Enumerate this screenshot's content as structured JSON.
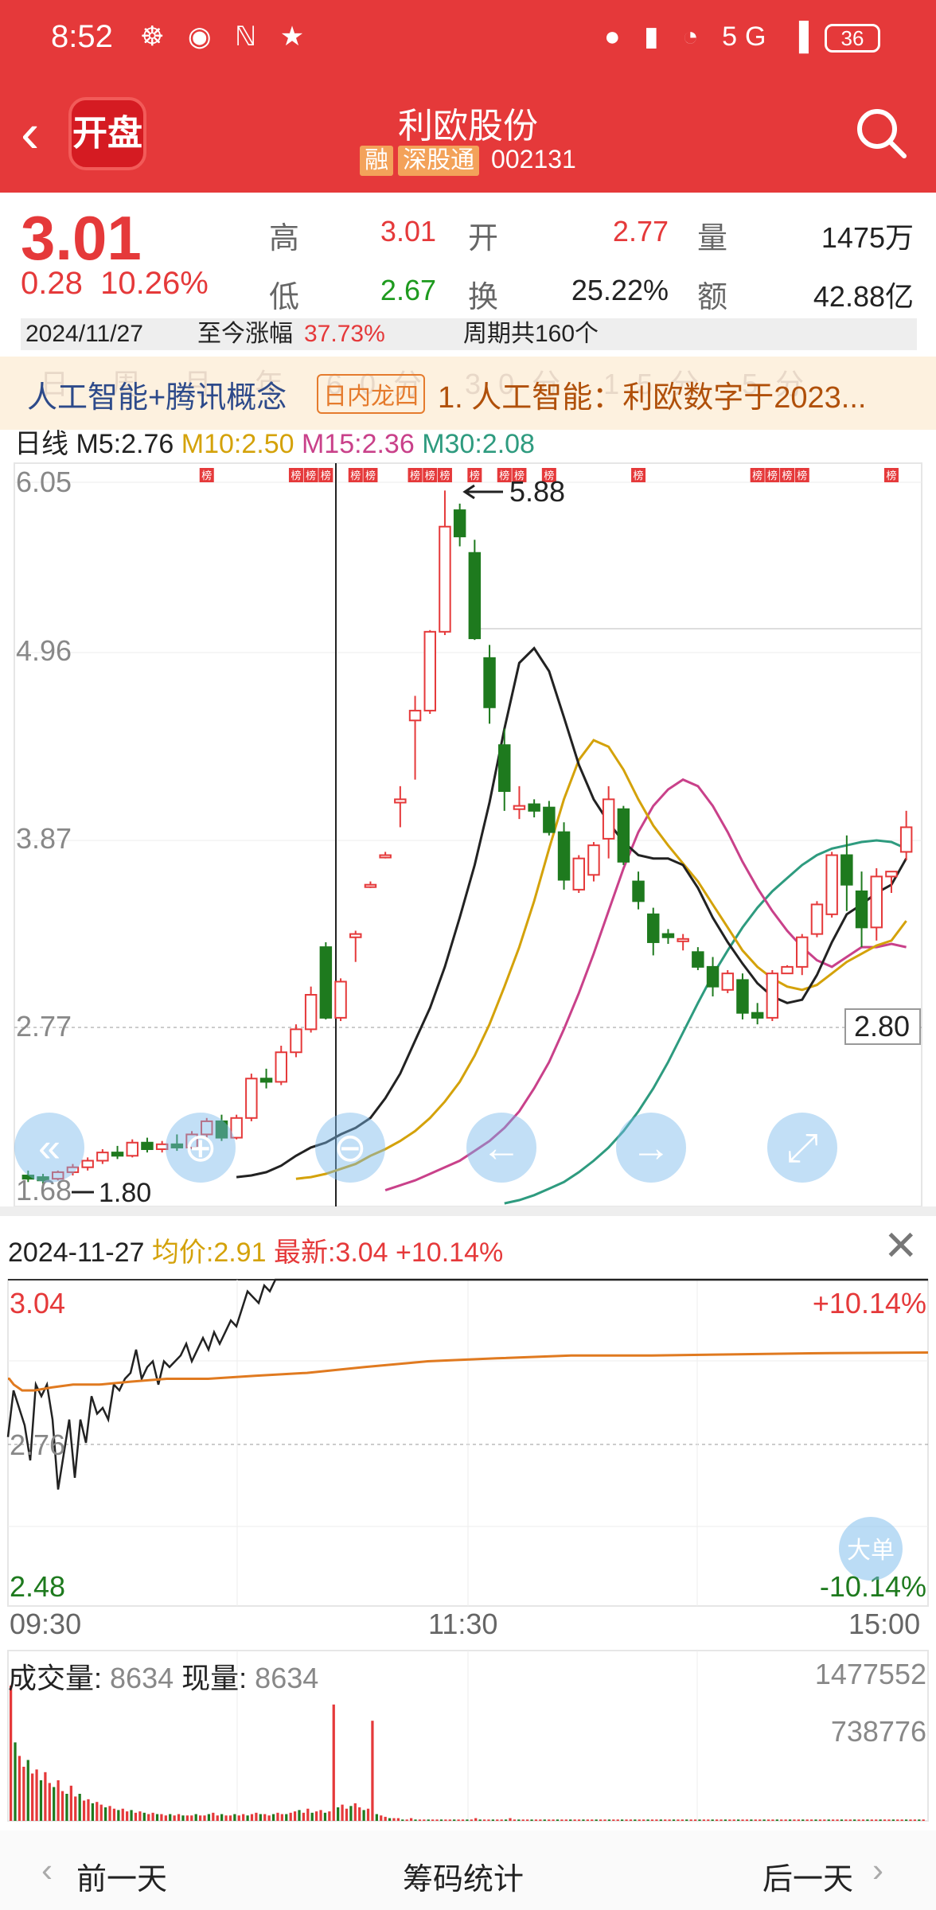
{
  "status_bar": {
    "time": "8:52",
    "battery": "36",
    "left_icons": "☸ ◉ ℕ ★",
    "right_icons": "● ▮ ◔ 5G ▐"
  },
  "header": {
    "app_logo_text": "开盘",
    "stock_name": "利欧股份",
    "tags": [
      "融",
      "深股通"
    ],
    "code": "002131"
  },
  "quote": {
    "price": "3.01",
    "change": "0.28",
    "change_pct": "10.26%",
    "high_label": "高",
    "high": "3.01",
    "open_label": "开",
    "open": "2.77",
    "volume_label": "量",
    "volume": "1475万",
    "low_label": "低",
    "low": "2.67",
    "turnover_label": "换",
    "turnover": "25.22%",
    "amount_label": "额",
    "amount": "42.88亿",
    "date": "2024/11/27",
    "cum_label": "至今涨幅",
    "cum_value": "37.73%",
    "period_text": "周期共160个"
  },
  "concept_bar": {
    "ghost_tabs": "日 周 月 年 60分 30分 15分 5分",
    "concepts": "人工智能+腾讯概念",
    "badge": "日内龙四",
    "news": "1. 人工智能：利欧数字于2023..."
  },
  "ma_legend": {
    "label": "日线",
    "m5": "M5:2.76",
    "m10": "M10:2.50",
    "m15": "M15:2.36",
    "m30": "M30:2.08"
  },
  "colors": {
    "up": "#e5393a",
    "down": "#1e7a1e",
    "m5": "#222222",
    "m10": "#d4a20a",
    "m15": "#c9418a",
    "m30": "#2e9b7f"
  },
  "kline": {
    "y_labels": [
      "6.05",
      "4.96",
      "3.87",
      "2.77",
      "1.68"
    ],
    "marker_high": "5.88",
    "marker_low": "1.80",
    "last_price_box": "2.80",
    "bang": "榜",
    "nav_icons": [
      "double-left-icon",
      "zoom-in-icon",
      "zoom-out-icon",
      "left-arrow-icon",
      "right-arrow-icon",
      "expand-icon"
    ]
  },
  "chart_data": [
    {
      "type": "candlestick",
      "title": "",
      "ylim": [
        1.68,
        6.05
      ],
      "y_ticks": [
        6.05,
        4.96,
        3.87,
        2.77,
        1.68
      ],
      "candles": [
        [
          1.83,
          1.86,
          1.79,
          1.81
        ],
        [
          1.82,
          1.84,
          1.78,
          1.8
        ],
        [
          1.81,
          1.86,
          1.8,
          1.85
        ],
        [
          1.85,
          1.9,
          1.83,
          1.88
        ],
        [
          1.88,
          1.94,
          1.86,
          1.92
        ],
        [
          1.92,
          1.99,
          1.9,
          1.97
        ],
        [
          1.97,
          2.01,
          1.93,
          1.95
        ],
        [
          1.95,
          2.05,
          1.94,
          2.03
        ],
        [
          2.03,
          2.06,
          1.97,
          1.99
        ],
        [
          1.99,
          2.04,
          1.97,
          2.02
        ],
        [
          2.02,
          2.08,
          1.98,
          2.0
        ],
        [
          2.0,
          2.1,
          1.99,
          2.08
        ],
        [
          2.08,
          2.18,
          2.06,
          2.16
        ],
        [
          2.16,
          2.2,
          2.04,
          2.06
        ],
        [
          2.06,
          2.2,
          2.05,
          2.18
        ],
        [
          2.18,
          2.45,
          2.16,
          2.42
        ],
        [
          2.42,
          2.48,
          2.36,
          2.4
        ],
        [
          2.4,
          2.62,
          2.38,
          2.58
        ],
        [
          2.58,
          2.75,
          2.55,
          2.72
        ],
        [
          2.72,
          2.98,
          2.7,
          2.93
        ],
        [
          3.22,
          3.25,
          2.78,
          2.79
        ],
        [
          2.79,
          3.03,
          2.77,
          3.01
        ],
        [
          3.28,
          3.32,
          3.13,
          3.3
        ],
        [
          3.6,
          3.62,
          3.58,
          3.6
        ],
        [
          3.78,
          3.8,
          3.76,
          3.78
        ],
        [
          4.1,
          4.2,
          3.95,
          4.12
        ],
        [
          4.6,
          4.75,
          4.24,
          4.66
        ],
        [
          4.66,
          5.15,
          4.64,
          5.14
        ],
        [
          5.14,
          6.0,
          5.12,
          5.78
        ],
        [
          5.88,
          5.92,
          5.66,
          5.72
        ],
        [
          5.62,
          5.7,
          5.09,
          5.1
        ],
        [
          4.98,
          5.06,
          4.58,
          4.68
        ],
        [
          4.45,
          4.55,
          4.05,
          4.17
        ],
        [
          4.06,
          4.2,
          4.0,
          4.08
        ],
        [
          4.09,
          4.12,
          4.01,
          4.05
        ],
        [
          4.07,
          4.11,
          3.9,
          3.92
        ],
        [
          3.92,
          3.98,
          3.57,
          3.63
        ],
        [
          3.57,
          3.78,
          3.55,
          3.76
        ],
        [
          3.66,
          3.86,
          3.62,
          3.84
        ],
        [
          3.88,
          4.2,
          3.76,
          4.12
        ],
        [
          4.06,
          4.08,
          3.72,
          3.74
        ],
        [
          3.62,
          3.68,
          3.45,
          3.5
        ],
        [
          3.42,
          3.46,
          3.17,
          3.25
        ],
        [
          3.3,
          3.33,
          3.24,
          3.28
        ],
        [
          3.26,
          3.3,
          3.2,
          3.27
        ],
        [
          3.19,
          3.22,
          3.08,
          3.1
        ],
        [
          3.1,
          3.16,
          2.92,
          2.98
        ],
        [
          2.96,
          3.08,
          2.94,
          3.06
        ],
        [
          3.02,
          3.06,
          2.78,
          2.82
        ],
        [
          2.82,
          2.88,
          2.75,
          2.79
        ],
        [
          2.79,
          3.08,
          2.77,
          3.06
        ],
        [
          3.06,
          3.11,
          3.08,
          3.1
        ],
        [
          3.1,
          3.3,
          3.05,
          3.28
        ],
        [
          3.3,
          3.5,
          3.28,
          3.48
        ],
        [
          3.42,
          3.8,
          3.4,
          3.78
        ],
        [
          3.78,
          3.9,
          3.44,
          3.6
        ],
        [
          3.56,
          3.68,
          3.22,
          3.34
        ],
        [
          3.34,
          3.7,
          3.26,
          3.65
        ],
        [
          3.65,
          3.68,
          3.55,
          3.68
        ],
        [
          3.8,
          4.05,
          3.75,
          3.95
        ]
      ],
      "ma5": [
        1.82,
        1.83,
        1.85,
        1.89,
        1.95,
        2.0,
        2.03,
        2.08,
        2.12,
        2.18,
        2.3,
        2.45,
        2.65,
        2.85,
        3.1,
        3.4,
        3.72,
        4.1,
        4.55,
        4.95,
        5.04,
        4.9,
        4.62,
        4.33,
        4.12,
        3.98,
        3.86,
        3.78,
        3.76,
        3.76,
        3.72,
        3.58,
        3.4,
        3.25,
        3.12,
        3.0,
        2.92,
        2.88,
        2.9,
        3.05,
        3.25,
        3.42,
        3.48,
        3.55,
        3.6,
        3.76
      ],
      "ma10": [
        1.81,
        1.82,
        1.84,
        1.87,
        1.9,
        1.95,
        1.99,
        2.04,
        2.1,
        2.18,
        2.28,
        2.4,
        2.56,
        2.75,
        2.98,
        3.22,
        3.5,
        3.82,
        4.12,
        4.36,
        4.48,
        4.44,
        4.3,
        4.12,
        3.96,
        3.84,
        3.73,
        3.62,
        3.48,
        3.34,
        3.2,
        3.1,
        3.03,
        2.98,
        2.96,
        2.99,
        3.06,
        3.13,
        3.18,
        3.23,
        3.26,
        3.38
      ],
      "ma15": [
        1.74,
        1.77,
        1.8,
        1.84,
        1.88,
        1.92,
        1.98,
        2.04,
        2.12,
        2.22,
        2.36,
        2.52,
        2.72,
        2.94,
        3.18,
        3.44,
        3.7,
        3.92,
        4.08,
        4.18,
        4.24,
        4.2,
        4.08,
        3.92,
        3.74,
        3.58,
        3.44,
        3.32,
        3.22,
        3.14,
        3.1,
        3.16,
        3.22,
        3.22,
        3.24,
        3.22
      ],
      "ma30": [
        1.66,
        1.68,
        1.71,
        1.75,
        1.79,
        1.85,
        1.92,
        2.0,
        2.1,
        2.22,
        2.36,
        2.52,
        2.7,
        2.88,
        3.05,
        3.2,
        3.34,
        3.46,
        3.56,
        3.64,
        3.72,
        3.78,
        3.82,
        3.84,
        3.86,
        3.87,
        3.86,
        3.82
      ]
    },
    {
      "type": "line",
      "title": "",
      "date": "2024-11-27",
      "avg_label": "均价:",
      "avg": "2.91",
      "last_label": "最新:",
      "last": "3.04",
      "last_pct": "+10.14%",
      "ylim": [
        2.48,
        3.04
      ],
      "y_labels": {
        "top": "3.04",
        "mid": "2.76",
        "bottom": "2.48",
        "top_pct": "+10.14%",
        "bottom_pct": "-10.14%"
      },
      "x_labels": [
        "09:30",
        "11:30",
        "15:00"
      ],
      "big_order": "大单",
      "price": [
        2.77,
        2.85,
        2.82,
        2.79,
        2.73,
        2.86,
        2.84,
        2.86,
        2.8,
        2.68,
        2.74,
        2.8,
        2.7,
        2.8,
        2.76,
        2.84,
        2.81,
        2.82,
        2.8,
        2.86,
        2.85,
        2.87,
        2.88,
        2.92,
        2.87,
        2.89,
        2.9,
        2.86,
        2.9,
        2.89,
        2.9,
        2.91,
        2.93,
        2.9,
        2.92,
        2.94,
        2.92,
        2.95,
        2.93,
        2.95,
        2.97,
        2.96,
        2.99,
        3.02,
        3.01,
        3.0,
        3.03,
        3.02,
        3.04
      ],
      "price_after": 3.04,
      "avg_series": [
        2.87,
        2.87,
        2.86,
        2.85,
        2.85,
        2.855,
        2.86,
        2.86,
        2.865,
        2.87,
        2.87,
        2.875,
        2.88,
        2.89,
        2.9,
        2.905,
        2.91,
        2.91,
        2.912,
        2.914,
        2.915
      ]
    },
    {
      "type": "bar",
      "title": "",
      "label": "成交量:",
      "value": "8634",
      "now_label": "现量:",
      "now": "8634",
      "y_labels": [
        "1477552",
        "738776"
      ],
      "values": [
        1.0,
        0.58,
        0.48,
        0.4,
        0.45,
        0.35,
        0.38,
        0.3,
        0.36,
        0.28,
        0.25,
        0.3,
        0.22,
        0.2,
        0.26,
        0.18,
        0.2,
        0.15,
        0.16,
        0.13,
        0.14,
        0.12,
        0.1,
        0.11,
        0.09,
        0.08,
        0.09,
        0.07,
        0.08,
        0.06,
        0.07,
        0.06,
        0.05,
        0.06,
        0.05,
        0.05,
        0.04,
        0.05,
        0.04,
        0.05,
        0.04,
        0.04,
        0.04,
        0.05,
        0.04,
        0.04,
        0.05,
        0.06,
        0.04,
        0.05,
        0.04,
        0.04,
        0.05,
        0.04,
        0.05,
        0.04,
        0.05,
        0.06,
        0.05,
        0.05,
        0.04,
        0.05,
        0.06,
        0.05,
        0.05,
        0.06,
        0.07,
        0.08,
        0.06,
        0.09,
        0.06,
        0.07,
        0.08,
        0.06,
        0.07,
        0.86,
        0.1,
        0.12,
        0.09,
        0.11,
        0.13,
        0.1,
        0.08,
        0.09,
        0.74,
        0.05,
        0.04,
        0.03,
        0.02,
        0.02,
        0.02,
        0.01,
        0.01,
        0.02,
        0.01,
        0.01,
        0.01,
        0.01,
        0.01,
        0.01,
        0.01,
        0.01,
        0.01,
        0.01,
        0.01,
        0.01,
        0.01,
        0.01,
        0.02,
        0.01,
        0.01,
        0.01,
        0.01,
        0.01,
        0.01,
        0.01,
        0.02,
        0.01,
        0.01,
        0.01,
        0.01,
        0.01,
        0.01,
        0.01,
        0.01,
        0.01,
        0.01,
        0.01,
        0.01,
        0.01,
        0.01,
        0.01,
        0.01,
        0.01,
        0.01,
        0.01,
        0.01,
        0.01,
        0.01,
        0.01,
        0.01,
        0.01,
        0.01,
        0.01,
        0.01,
        0.01,
        0.01,
        0.01,
        0.01,
        0.01,
        0.01,
        0.01,
        0.01,
        0.01,
        0.01,
        0.01,
        0.01,
        0.01,
        0.01,
        0.01,
        0.01,
        0.01,
        0.01,
        0.01,
        0.01,
        0.01,
        0.01,
        0.01,
        0.01,
        0.01,
        0.01,
        0.01,
        0.01,
        0.01,
        0.01,
        0.01,
        0.01,
        0.01,
        0.01,
        0.01,
        0.01,
        0.01,
        0.01,
        0.01,
        0.01,
        0.01,
        0.01,
        0.01,
        0.01,
        0.01,
        0.01,
        0.01,
        0.01,
        0.01,
        0.01,
        0.01,
        0.01,
        0.01,
        0.01,
        0.01,
        0.01,
        0.01,
        0.01,
        0.01,
        0.01,
        0.01,
        0.01,
        0.01,
        0.01,
        0.01,
        0.01,
        0.01,
        0.01
      ]
    }
  ],
  "bottom_nav": {
    "prev": "前一天",
    "mid": "筹码统计",
    "next": "后一天"
  }
}
